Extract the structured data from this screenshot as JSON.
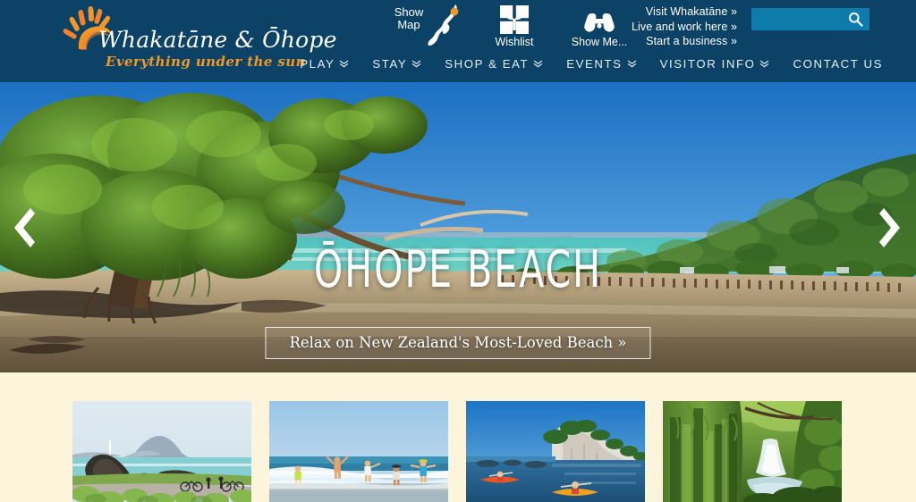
{
  "site": {
    "logo_name": "Whakatāne & Ōhope",
    "logo_tagline": "Everything under the sun",
    "logo_icon": "sunburst-icon"
  },
  "header": {
    "utilities": [
      {
        "label_line1": "Show",
        "label_line2": "Map",
        "icon": "new-zealand-map-icon",
        "name": "show-map"
      },
      {
        "label": "Wishlist",
        "icon": "gift-box-icon",
        "name": "wishlist"
      },
      {
        "label": "Show Me...",
        "icon": "binoculars-icon",
        "name": "show-me"
      }
    ],
    "top_links": [
      "Visit Whakatāne »",
      "Live and work here »",
      "Start a business »"
    ],
    "search": {
      "value": "",
      "placeholder": "",
      "icon": "search-icon",
      "background": "#0d7bab"
    },
    "background": "#0b4266"
  },
  "nav": {
    "items": [
      {
        "label": "PLAY",
        "has_dropdown": true
      },
      {
        "label": "STAY",
        "has_dropdown": true
      },
      {
        "label": "SHOP & EAT",
        "has_dropdown": true
      },
      {
        "label": "EVENTS",
        "has_dropdown": true
      },
      {
        "label": "VISITOR INFO",
        "has_dropdown": true
      },
      {
        "label": "CONTACT US",
        "has_dropdown": false
      }
    ]
  },
  "hero": {
    "title": "ŌHOPE BEACH",
    "cta": "Relax on New Zealand's Most-Loved Beach »",
    "prev_arrow": "chevron-left-icon",
    "next_arrow": "chevron-right-icon",
    "image_alt": "Ōhope Beach with pohutukawa tree, turquoise sea and forested hills"
  },
  "cards": [
    {
      "name": "card-coastal-lookout",
      "alt": "Rocky headland with Whale Island and cyclists on coastal path"
    },
    {
      "name": "card-beach-kids",
      "alt": "Children running in the surf at the beach"
    },
    {
      "name": "card-kayaking",
      "alt": "Kayakers paddling beside white cliffs"
    },
    {
      "name": "card-forest-waterfall",
      "alt": "Mossy forest gorge with waterfall"
    }
  ],
  "colors": {
    "navy": "#0b4266",
    "teal": "#0d7bab",
    "orange": "#f0982a",
    "cream": "#fdf4dc"
  }
}
